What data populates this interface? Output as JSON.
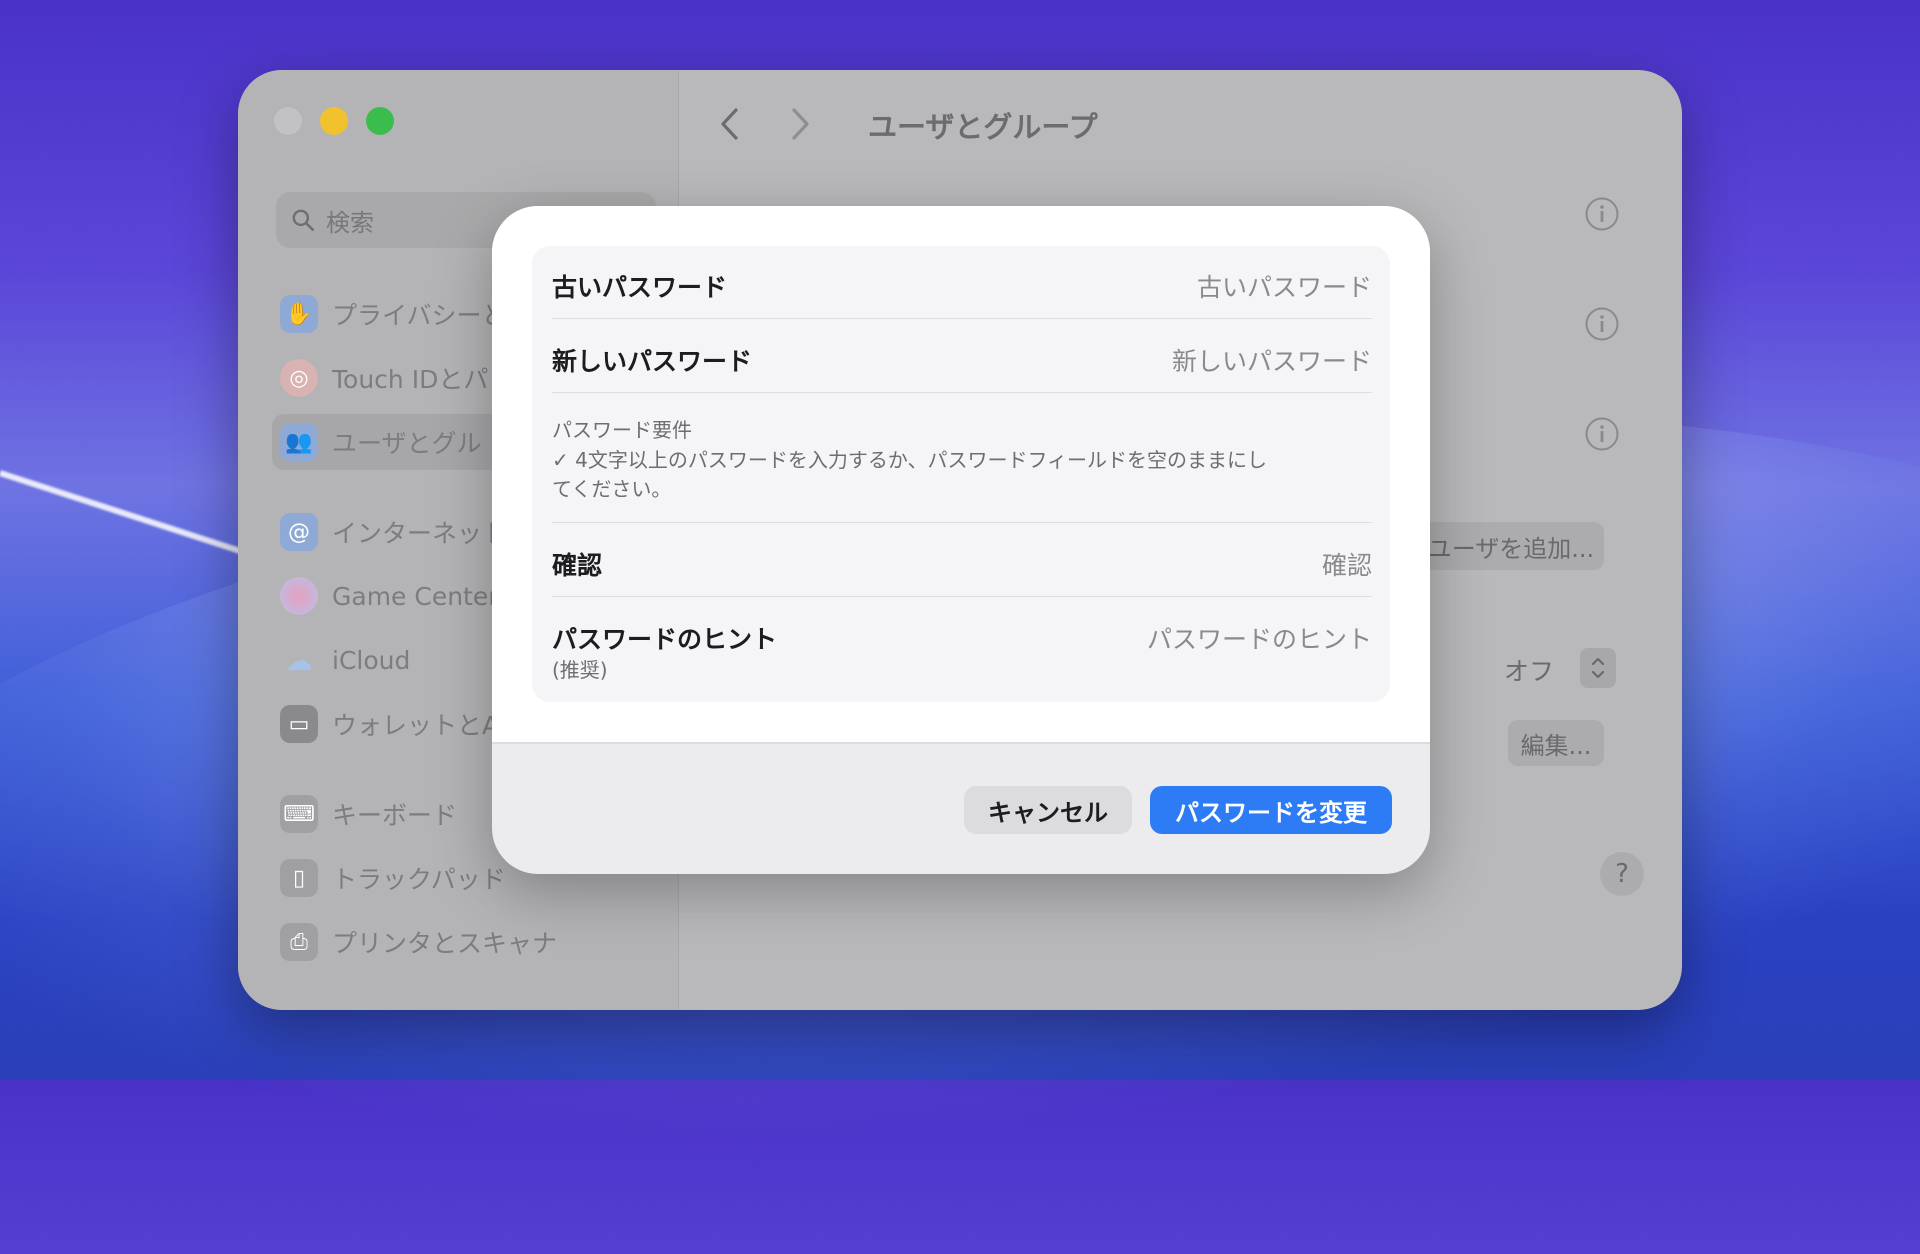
{
  "window": {
    "title": "ユーザとグループ"
  },
  "sidebar": {
    "search_placeholder": "検索",
    "items": [
      {
        "label": "プライバシーと",
        "icon": "hand-icon",
        "color": "#3a7ef7"
      },
      {
        "label": "Touch IDとパ",
        "icon": "fingerprint-icon",
        "color": "#f06a6a"
      },
      {
        "label": "ユーザとグル",
        "icon": "users-icon",
        "color": "#3a7ef7",
        "selected": true
      },
      {
        "label": "インターネット",
        "icon": "at-icon",
        "color": "#3a7ef7"
      },
      {
        "label": "Game Center",
        "icon": "game-center-icon",
        "color": "#e0a060"
      },
      {
        "label": "iCloud",
        "icon": "cloud-icon",
        "color": "#6fa8f0"
      },
      {
        "label": "ウォレットとA",
        "icon": "wallet-icon",
        "color": "#444446"
      },
      {
        "label": "キーボード",
        "icon": "keyboard-icon",
        "color": "#8e8e92"
      },
      {
        "label": "トラックパッド",
        "icon": "trackpad-icon",
        "color": "#8e8e92"
      },
      {
        "label": "プリンタとスキャナ",
        "icon": "printer-icon",
        "color": "#8e8e92"
      }
    ]
  },
  "background_panel": {
    "add_user_label": "ユーザを追加...",
    "off_label": "オフ",
    "edit_label": "編集...",
    "help_label": "?"
  },
  "dialog": {
    "old_password_label": "古いパスワード",
    "old_password_placeholder": "古いパスワード",
    "new_password_label": "新しいパスワード",
    "new_password_placeholder": "新しいパスワード",
    "requirements_title": "パスワード要件",
    "requirements_text": "✓ 4文字以上のパスワードを入力するか、パスワードフィールドを空のままにしてください。",
    "confirm_label": "確認",
    "confirm_placeholder": "確認",
    "hint_label": "パスワードのヒント",
    "hint_sublabel": "(推奨)",
    "hint_placeholder": "パスワードのヒント",
    "cancel_label": "キャンセル",
    "change_label": "パスワードを変更"
  },
  "colors": {
    "accent": "#2d7cf6",
    "close": "#c2c2c4",
    "minimize": "#f1c12e",
    "maximize": "#3bbd4e"
  }
}
